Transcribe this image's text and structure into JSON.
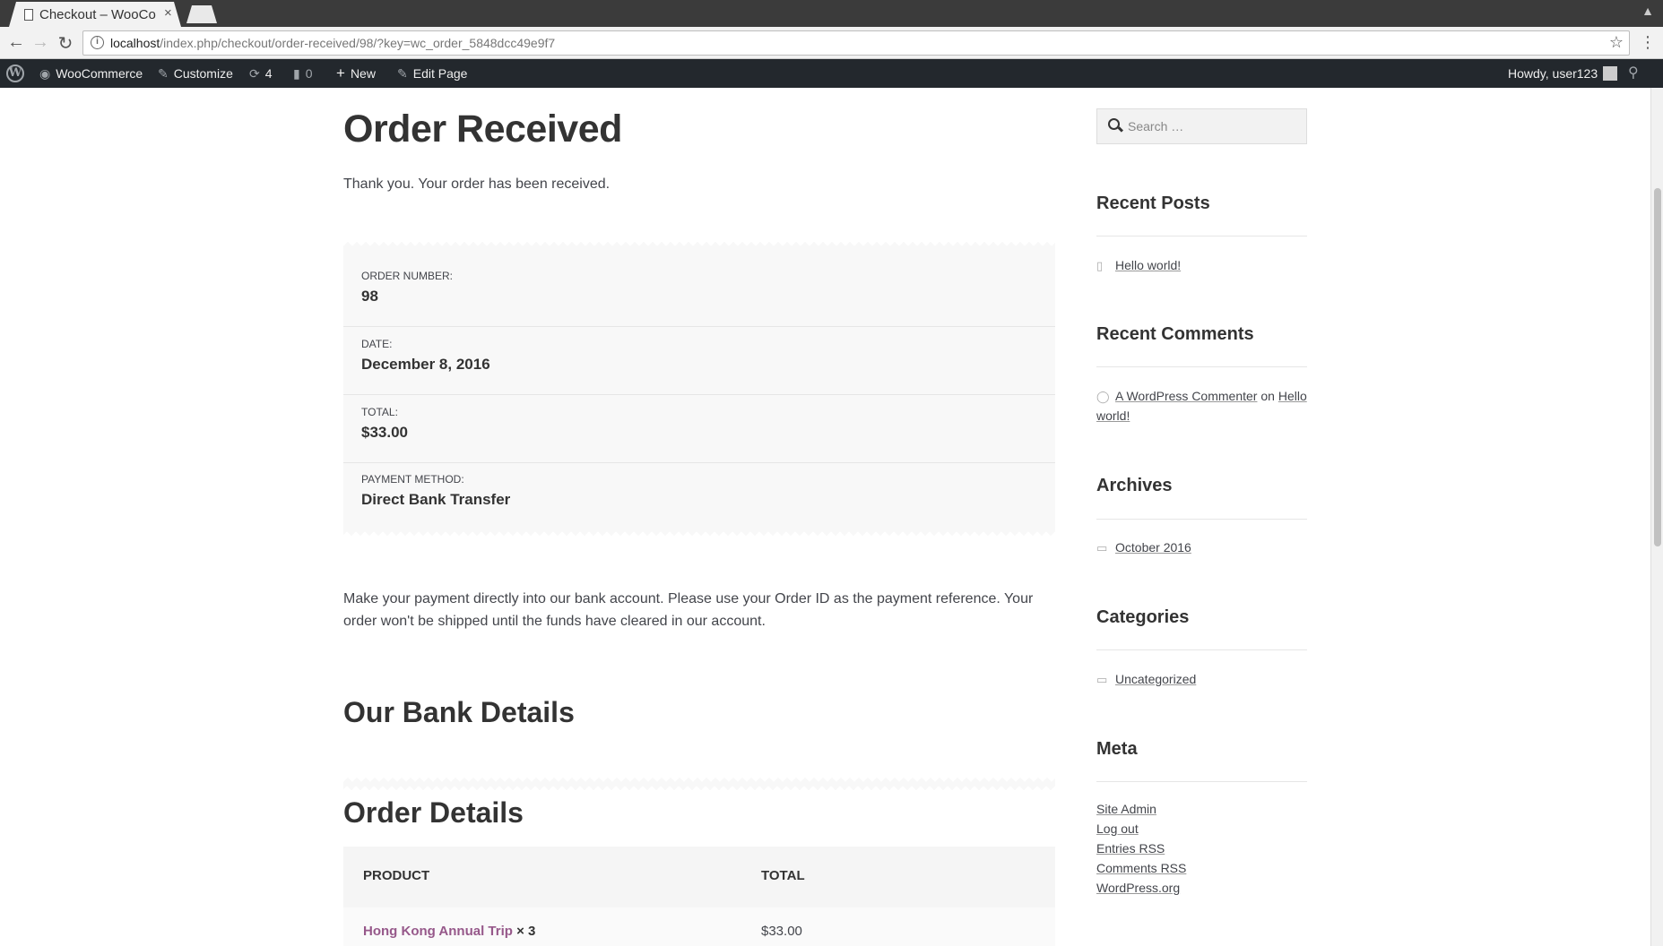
{
  "browser": {
    "tab_title": "Checkout – WooCo",
    "tab_close": "×",
    "url_host": "localhost",
    "url_path": "/index.php/checkout/order-received/98/?key=wc_order_5848dcc49e9f7",
    "back": "←",
    "forward": "→",
    "reload": "↻",
    "star": "☆",
    "menu": "⋮"
  },
  "adminbar": {
    "site": "WooCommerce",
    "customize": "Customize",
    "updates_count": "4",
    "comments_count": "0",
    "new": "New",
    "edit_page": "Edit Page",
    "howdy": "Howdy, user123"
  },
  "page": {
    "title": "Order Received",
    "thanks": "Thank you. Your order has been received.",
    "overview": [
      {
        "label": "ORDER NUMBER:",
        "value": "98"
      },
      {
        "label": "DATE:",
        "value": "December 8, 2016"
      },
      {
        "label": "TOTAL:",
        "value": "$33.00"
      },
      {
        "label": "PAYMENT METHOD:",
        "value": "Direct Bank Transfer"
      }
    ],
    "bacs_text": "Make your payment directly into our bank account. Please use your Order ID as the payment reference. Your order won't be shipped until the funds have cleared in our account.",
    "bank_details_title": "Our Bank Details",
    "order_details_title": "Order Details",
    "table": {
      "headers": [
        "PRODUCT",
        "TOTAL"
      ],
      "rows": [
        {
          "product": "Hong Kong Annual Trip",
          "qty": " × 3",
          "total": "$33.00"
        }
      ]
    }
  },
  "sidebar": {
    "search_placeholder": "Search …",
    "recent_posts_title": "Recent Posts",
    "recent_posts": [
      "Hello world!"
    ],
    "recent_comments_title": "Recent Comments",
    "comment_author": "A WordPress Commenter",
    "comment_on": " on ",
    "comment_post_1": "Hello",
    "comment_post_2": "world!",
    "archives_title": "Archives",
    "archives": [
      "October 2016"
    ],
    "categories_title": "Categories",
    "categories": [
      "Uncategorized"
    ],
    "meta_title": "Meta",
    "meta_links": [
      "Site Admin",
      "Log out",
      "Entries RSS",
      "Comments RSS",
      "WordPress.org"
    ]
  }
}
